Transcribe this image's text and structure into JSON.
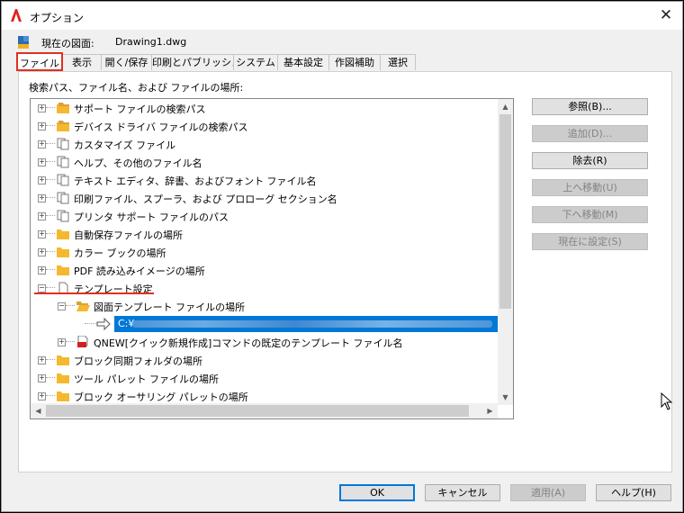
{
  "window": {
    "title": "オプション",
    "close_glyph": "✕"
  },
  "current_drawing": {
    "label": "現在の図面:",
    "value": "Drawing1.dwg"
  },
  "tabs": [
    {
      "label": "ファイル",
      "active": true
    },
    {
      "label": "表示"
    },
    {
      "label": "開く/保存"
    },
    {
      "label": "印刷とパブリッシュ"
    },
    {
      "label": "システム"
    },
    {
      "label": "基本設定"
    },
    {
      "label": "作図補助"
    },
    {
      "label": "選択"
    }
  ],
  "files_panel": {
    "label": "検索パス、ファイル名、および ファイルの場所:",
    "tree": [
      {
        "label": "サポート ファイルの検索パス",
        "icon": "folder-stack-icon",
        "expander": "+"
      },
      {
        "label": "デバイス ドライバ ファイルの検索パス",
        "icon": "folder-stack-icon",
        "expander": "+"
      },
      {
        "label": "カスタマイズ ファイル",
        "icon": "files-icon",
        "expander": "+"
      },
      {
        "label": "ヘルプ、その他のファイル名",
        "icon": "files-icon",
        "expander": "+"
      },
      {
        "label": "テキスト エディタ、辞書、およびフォント ファイル名",
        "icon": "files-icon",
        "expander": "+"
      },
      {
        "label": "印刷ファイル、スプーラ、および プロローグ セクション名",
        "icon": "files-icon",
        "expander": "+"
      },
      {
        "label": "プリンタ サポート ファイルのパス",
        "icon": "files-icon",
        "expander": "+"
      },
      {
        "label": "自動保存ファイルの場所",
        "icon": "folder-icon",
        "expander": "+"
      },
      {
        "label": "カラー ブックの場所",
        "icon": "folder-icon",
        "expander": "+"
      },
      {
        "label": "PDF 読み込みイメージの場所",
        "icon": "folder-icon",
        "expander": "+"
      },
      {
        "label": "テンプレート設定",
        "icon": "file-icon",
        "expander": "−"
      },
      {
        "label": "図面テンプレート ファイルの場所",
        "icon": "open-folder-icon",
        "expander": "−",
        "level": 1
      },
      {
        "label": "C:¥",
        "icon": "arrow-right-icon",
        "level": 2,
        "selected": true
      },
      {
        "label": "QNEW[クイック新規作成]コマンドの既定のテンプレート ファイル名",
        "icon": "dwt-file-icon",
        "expander": "+",
        "level": 1
      },
      {
        "label": "ブロック同期フォルダの場所",
        "icon": "folder-icon",
        "expander": "+"
      },
      {
        "label": "ツール パレット ファイルの場所",
        "icon": "folder-icon",
        "expander": "+"
      },
      {
        "label": "ブロック オーサリング パレットの場所",
        "icon": "folder-icon",
        "expander": "+"
      }
    ],
    "side_buttons": [
      {
        "label": "参照(B)...",
        "enabled": true
      },
      {
        "label": "追加(D)...",
        "enabled": false
      },
      {
        "label": "除去(R)",
        "enabled": true
      },
      {
        "label": "上へ移動(U)",
        "enabled": false
      },
      {
        "label": "下へ移動(M)",
        "enabled": false
      },
      {
        "label": "現在に設定(S)",
        "enabled": false
      }
    ]
  },
  "footer_buttons": [
    {
      "label": "OK",
      "enabled": true,
      "default": true
    },
    {
      "label": "キャンセル",
      "enabled": true
    },
    {
      "label": "適用(A)",
      "enabled": false
    },
    {
      "label": "ヘルプ(H)",
      "enabled": true
    }
  ],
  "colors": {
    "accent": "#0078d7",
    "highlight": "#e03020",
    "folder": "#f5b82e"
  }
}
